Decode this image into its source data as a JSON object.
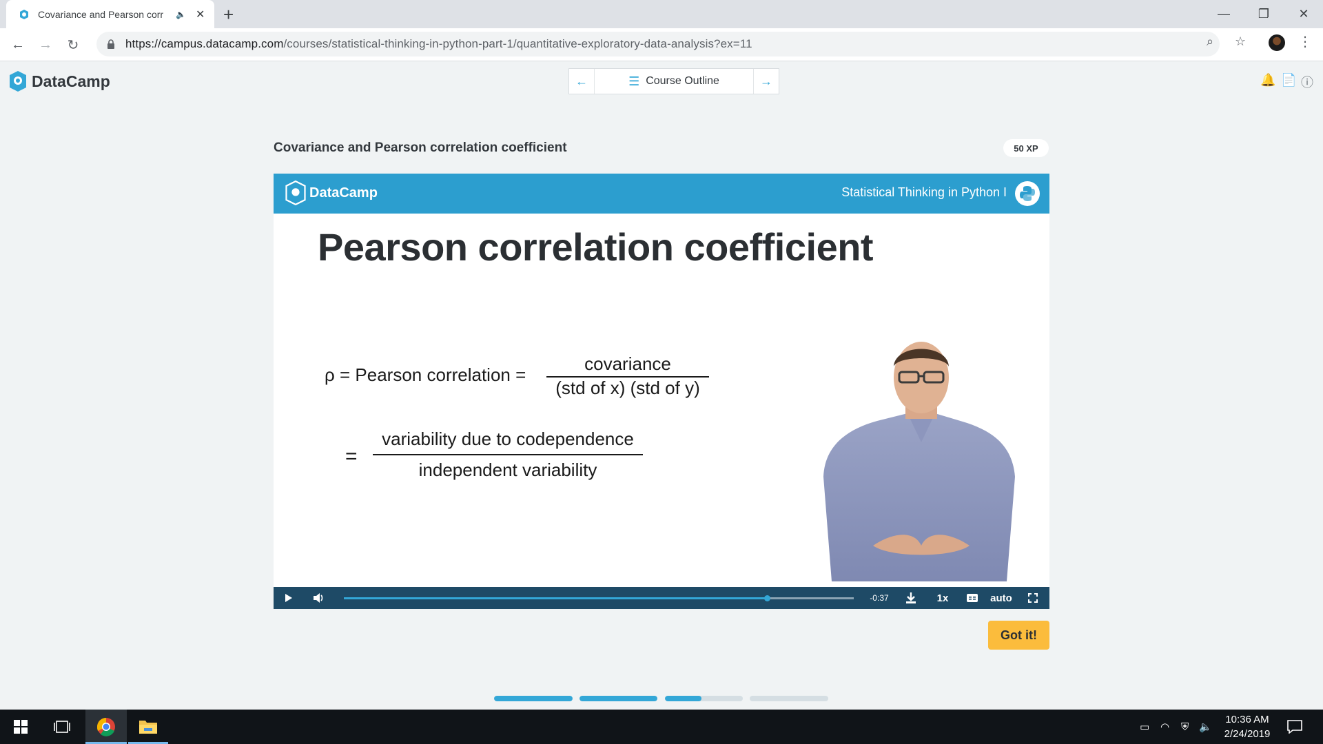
{
  "browser": {
    "tab_title": "Covariance and Pearson corr",
    "url_host": "https://campus.datacamp.com",
    "url_path": "/courses/statistical-thinking-in-python-part-1/quantitative-exploratory-data-analysis?ex=11"
  },
  "header": {
    "logo_text": "DataCamp",
    "course_outline_label": "Course Outline"
  },
  "exercise": {
    "title": "Covariance and Pearson correlation coefficient",
    "xp": "50 XP",
    "got_it_label": "Got it!"
  },
  "video": {
    "brand": "DataCamp",
    "course_name": "Statistical Thinking in Python I",
    "slide_title": "Pearson correlation coefficient",
    "rho_line_left": "ρ = Pearson correlation =",
    "frac1_num": "covariance",
    "frac1_den": "(std of x) (std of y)",
    "equals": "=",
    "frac2_num": "variability due to codependence",
    "frac2_den": "independent variability",
    "time_remaining": "-0:37",
    "speed": "1x",
    "quality": "auto",
    "seek_fraction": 0.83
  },
  "progress_segments": [
    1.0,
    1.0,
    0.47,
    0.0
  ],
  "taskbar": {
    "time": "10:36 AM",
    "date": "2/24/2019"
  },
  "colors": {
    "brand_blue": "#2c9ecf",
    "accent": "#33a7d7",
    "got_it": "#fbbc3c",
    "controls": "#1e4a66"
  }
}
